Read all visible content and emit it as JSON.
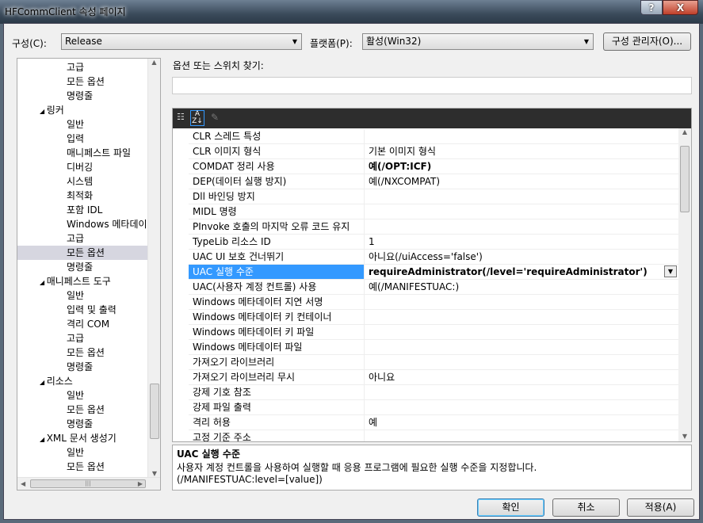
{
  "window": {
    "title": "HFCommClient 속성 페이지",
    "help": "?",
    "close": "X"
  },
  "config": {
    "label": "구성(C):",
    "value": "Release",
    "platform_label": "플랫폼(P):",
    "platform_value": "활성(Win32)",
    "manager_button": "구성 관리자(O)..."
  },
  "tree": {
    "items": [
      {
        "label": "고급",
        "level": 2
      },
      {
        "label": "모든 옵션",
        "level": 2
      },
      {
        "label": "명령줄",
        "level": 2
      },
      {
        "label": "링커",
        "level": 1,
        "expanded": true
      },
      {
        "label": "일반",
        "level": 2
      },
      {
        "label": "입력",
        "level": 2
      },
      {
        "label": "매니페스트 파일",
        "level": 2
      },
      {
        "label": "디버깅",
        "level": 2
      },
      {
        "label": "시스템",
        "level": 2
      },
      {
        "label": "최적화",
        "level": 2
      },
      {
        "label": "포함 IDL",
        "level": 2
      },
      {
        "label": "Windows 메타데이",
        "level": 2
      },
      {
        "label": "고급",
        "level": 2
      },
      {
        "label": "모든 옵션",
        "level": 2,
        "selected": true
      },
      {
        "label": "명령줄",
        "level": 2
      },
      {
        "label": "매니페스트 도구",
        "level": 1,
        "expanded": true
      },
      {
        "label": "일반",
        "level": 2
      },
      {
        "label": "입력 및 출력",
        "level": 2
      },
      {
        "label": "격리 COM",
        "level": 2
      },
      {
        "label": "고급",
        "level": 2
      },
      {
        "label": "모든 옵션",
        "level": 2
      },
      {
        "label": "명령줄",
        "level": 2
      },
      {
        "label": "리소스",
        "level": 1,
        "expanded": true
      },
      {
        "label": "일반",
        "level": 2
      },
      {
        "label": "모든 옵션",
        "level": 2
      },
      {
        "label": "명령줄",
        "level": 2
      },
      {
        "label": "XML 문서 생성기",
        "level": 1,
        "expanded": true
      },
      {
        "label": "일반",
        "level": 2
      },
      {
        "label": "모든 옵션",
        "level": 2
      }
    ]
  },
  "search": {
    "label": "옵션 또는 스위치 찾기:",
    "value": ""
  },
  "grid": {
    "rows": [
      {
        "k": "CLR 스레드 특성",
        "v": ""
      },
      {
        "k": "CLR 이미지 형식",
        "v": "기본 이미지 형식"
      },
      {
        "k": "COMDAT 정리 사용",
        "v": "예(/OPT:ICF)",
        "bold": true
      },
      {
        "k": "DEP(데이터 실행 방지)",
        "v": "예(/NXCOMPAT)"
      },
      {
        "k": "Dll 바인딩 방지",
        "v": ""
      },
      {
        "k": "MIDL 명령",
        "v": ""
      },
      {
        "k": "PInvoke 호출의 마지막 오류 코드 유지",
        "v": ""
      },
      {
        "k": "TypeLib 리소스 ID",
        "v": "1"
      },
      {
        "k": "UAC UI 보호 건너뛰기",
        "v": "아니요(/uiAccess='false')"
      },
      {
        "k": "UAC 실행 수준",
        "v": "requireAdministrator(/level='requireAdministrator')",
        "selected": true
      },
      {
        "k": "UAC(사용자 계정 컨트롤) 사용",
        "v": "예(/MANIFESTUAC:)"
      },
      {
        "k": "Windows 메타데이터 지연 서명",
        "v": ""
      },
      {
        "k": "Windows 메타데이터 키 컨테이너",
        "v": ""
      },
      {
        "k": "Windows 메타데이터 키 파일",
        "v": ""
      },
      {
        "k": "Windows 메타데이터 파일",
        "v": ""
      },
      {
        "k": "가져오기 라이브러리",
        "v": ""
      },
      {
        "k": "가져오기 라이브러리 무시",
        "v": "아니요"
      },
      {
        "k": "강제 기호 참조",
        "v": ""
      },
      {
        "k": "강제 파일 출력",
        "v": ""
      },
      {
        "k": "격리 허용",
        "v": "예"
      },
      {
        "k": "고정 기준 주소",
        "v": ""
      }
    ]
  },
  "description": {
    "title": "UAC 실행 수준",
    "text": "사용자 계정 컨트롤을 사용하여 실행할 때 응용 프로그램에 필요한 실행 수준을 지정합니다.",
    "switch": "(/MANIFESTUAC:level=[value])"
  },
  "buttons": {
    "ok": "확인",
    "cancel": "취소",
    "apply": "적용(A)"
  }
}
